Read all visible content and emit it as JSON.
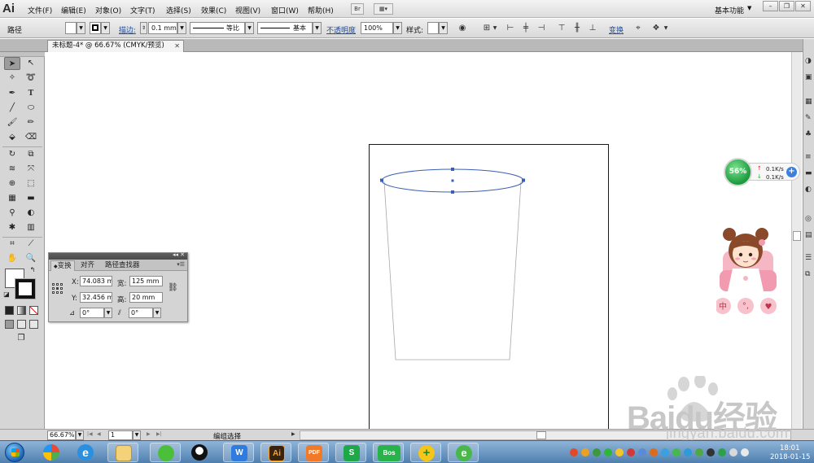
{
  "app": {
    "logo": "Ai"
  },
  "menu": {
    "items": [
      "文件(F)",
      "编辑(E)",
      "对象(O)",
      "文字(T)",
      "选择(S)",
      "效果(C)",
      "视图(V)",
      "窗口(W)",
      "帮助(H)"
    ],
    "bridge_label": "Br",
    "arrange_icon": "arrange-documents-icon",
    "workspace": "基本功能",
    "window_buttons": [
      "minimize",
      "restore",
      "close"
    ]
  },
  "control_bar": {
    "selection_type": "路径",
    "stroke_label": "描边:",
    "stroke_weight": "0.1 mm",
    "profile_label": "等比",
    "brush_label": "基本",
    "opacity_label": "不透明度",
    "opacity_value": "100%",
    "style_label": "样式:",
    "transform_label": "变换"
  },
  "document": {
    "tab_title": "未标题-4* @ 66.67% (CMYK/预览)"
  },
  "transform_panel": {
    "tabs": [
      "变换",
      "对齐",
      "路径查找器"
    ],
    "active_tab": "变换",
    "x_label": "X:",
    "x_value": "74.083 m",
    "y_label": "Y:",
    "y_value": "32.456 m",
    "w_label": "宽:",
    "w_value": "125 mm",
    "h_label": "高:",
    "h_value": "20 mm",
    "rotate_value": "0°",
    "shear_value": "0°"
  },
  "status_bar": {
    "zoom": "66.67%",
    "artboard": "1",
    "status_text": "编组选择"
  },
  "net_widget": {
    "percent": "56%",
    "upload": "0.1K/s",
    "download": "0.1K/s"
  },
  "watermark": {
    "logo": "Baidu经验",
    "url": "jingyan.baidu.com"
  },
  "taskbar": {
    "apps": [
      {
        "name": "start-button"
      },
      {
        "name": "360-browser",
        "glyph": ""
      },
      {
        "name": "internet-explorer",
        "glyph": "e"
      },
      {
        "name": "file-explorer",
        "glyph": ""
      },
      {
        "name": "wechat",
        "glyph": ""
      },
      {
        "name": "qq",
        "glyph": ""
      },
      {
        "name": "wps-writer",
        "glyph": "W"
      },
      {
        "name": "illustrator",
        "glyph": "Ai"
      },
      {
        "name": "pdf-reader",
        "glyph": "PDF"
      },
      {
        "name": "wps-spreadsheet",
        "glyph": "S"
      },
      {
        "name": "bos",
        "glyph": "Bos"
      },
      {
        "name": "360-security",
        "glyph": "+"
      },
      {
        "name": "360-update",
        "glyph": "e"
      }
    ],
    "time": "18:01",
    "date": "2018-01-15"
  },
  "colors": {
    "selection_blue": "#3b5fb5",
    "artboard_border": "#1a1a1a",
    "cup_stroke": "#a8a8a8",
    "link_blue": "#1f4ea0"
  }
}
